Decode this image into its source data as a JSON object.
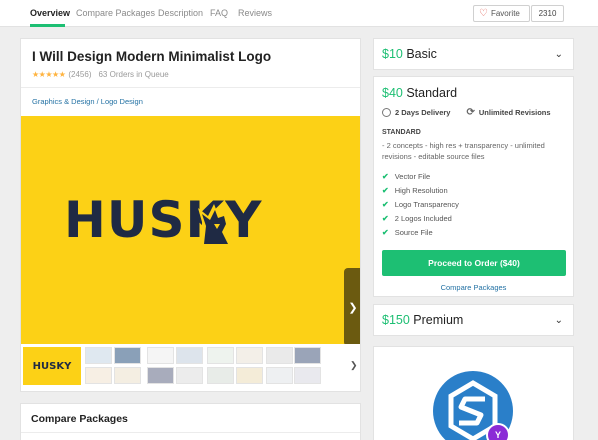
{
  "nav": {
    "tabs": [
      {
        "label": "Overview",
        "active": true
      },
      {
        "label": "Compare Packages",
        "active": false
      },
      {
        "label": "Description",
        "active": false
      },
      {
        "label": "FAQ",
        "active": false
      },
      {
        "label": "Reviews",
        "active": false
      }
    ],
    "favorite_label": "Favorite",
    "favorite_count": "2310"
  },
  "gig": {
    "title": "I Will Design Modern Minimalist Logo",
    "stars": "★★★★★",
    "rating_value": 5,
    "rating_count": "(2456)",
    "queue": "63 Orders in Queue",
    "breadcrumb": "Graphics & Design / Logo Design",
    "hero_text": "HUSKY",
    "thumb_text": "HUSKY"
  },
  "compare": {
    "title": "Compare Packages"
  },
  "packages": {
    "basic": {
      "price": "$10",
      "name": "Basic"
    },
    "standard": {
      "price": "$40",
      "name": "Standard",
      "delivery": "2 Days Delivery",
      "revisions": "Unlimited Revisions",
      "label": "STANDARD",
      "description": "- 2 concepts - high res + transparency - unlimited revisions - editable source files",
      "features": [
        "Vector File",
        "High Resolution",
        "Logo Transparency",
        "2 Logos Included",
        "Source File"
      ],
      "order_button": "Proceed to Order ($40)",
      "compare_link": "Compare Packages"
    },
    "premium": {
      "price": "$150",
      "name": "Premium"
    }
  },
  "colors": {
    "accent": "#1dbf73",
    "hero_bg": "#fcd116",
    "logo_text": "#1f2a44",
    "link": "#2472a4"
  }
}
